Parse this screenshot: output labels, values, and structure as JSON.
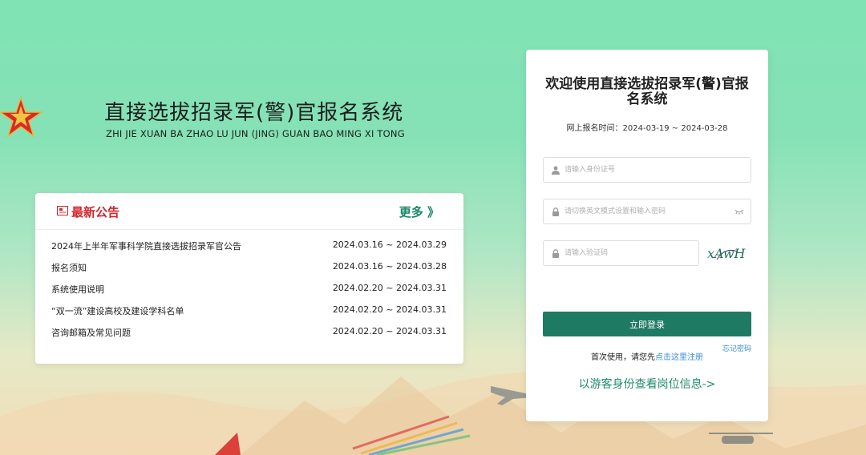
{
  "brand": {
    "title": "直接选拔招录军(警)官报名系统",
    "subtitle": "ZHI JIE XUAN BA ZHAO LU JUN (JING) GUAN BAO MING XI TONG"
  },
  "notices": {
    "header_title": "最新公告",
    "more_label": "更多 》",
    "items": [
      {
        "title": "2024年上半年军事科学院直接选拔招录军官公告",
        "date": "2024.03.16 ~ 2024.03.29"
      },
      {
        "title": "报名须知",
        "date": "2024.03.16 ~ 2024.03.28"
      },
      {
        "title": "系统使用说明",
        "date": "2024.02.20 ~ 2024.03.31"
      },
      {
        "title": "“双一流”建设高校及建设学科名单",
        "date": "2024.02.20 ~ 2024.03.31"
      },
      {
        "title": "咨询邮箱及常见问题",
        "date": "2024.02.20 ~ 2024.03.31"
      }
    ]
  },
  "login": {
    "title": "欢迎使用直接选拔招录军(警)官报名系统",
    "period": "网上报名时间：2024-03-19 ~ 2024-03-28",
    "id_placeholder": "请输入身份证号",
    "password_placeholder": "请切换英文模式设置和输入密码",
    "captcha_placeholder": "请输入验证码",
    "captcha_text": "xAwH",
    "login_button": "立即登录",
    "forgot_label": "忘记密码",
    "register_prefix": "首次使用，请您先",
    "register_link": "点击这里注册",
    "guest_link": "以游客身份查看岗位信息->"
  },
  "colors": {
    "accent": "#1f7a64",
    "notice_red": "#d6232b",
    "more_green": "#1a8a63",
    "link_blue": "#3c8fd8",
    "bg_top": "#7fe3b4"
  }
}
